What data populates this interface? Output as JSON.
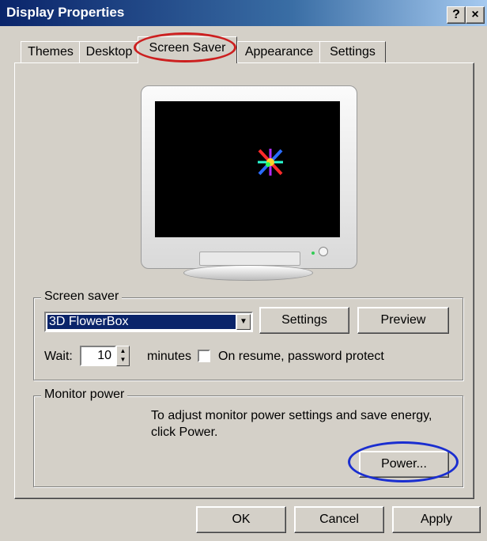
{
  "window": {
    "title": "Display Properties",
    "help_label": "?",
    "close_label": "×"
  },
  "tabs": [
    {
      "label": "Themes"
    },
    {
      "label": "Desktop"
    },
    {
      "label": "Screen Saver",
      "active": true
    },
    {
      "label": "Appearance"
    },
    {
      "label": "Settings"
    }
  ],
  "screen_saver": {
    "group_label": "Screen saver",
    "selected": "3D FlowerBox",
    "settings_label": "Settings",
    "preview_label": "Preview",
    "wait_label": "Wait:",
    "wait_value": "10",
    "minutes_label": "minutes",
    "password_label": "On resume, password protect",
    "password_checked": false
  },
  "monitor_power": {
    "group_label": "Monitor power",
    "description_line1": "To adjust monitor power settings and save energy,",
    "description_line2": "click Power.",
    "power_label": "Power..."
  },
  "footer": {
    "ok_label": "OK",
    "cancel_label": "Cancel",
    "apply_label": "Apply"
  },
  "annotations": {
    "tab_highlight_color": "#cc1f1f",
    "power_highlight_color": "#1a2ed0"
  }
}
